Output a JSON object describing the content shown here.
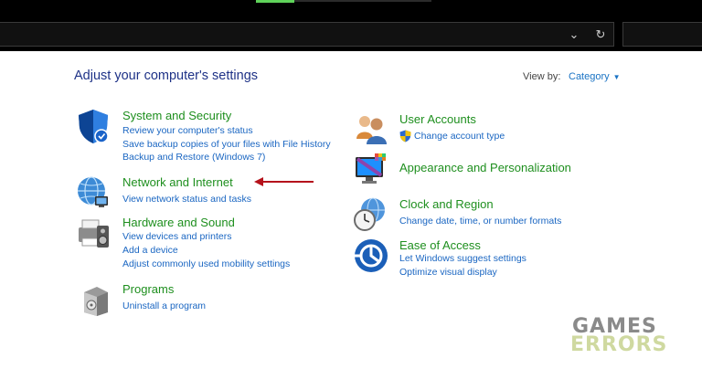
{
  "header": {
    "page_title": "Adjust your computer's settings",
    "view_by_label": "View by:",
    "view_by_value": "Category"
  },
  "categories": [
    {
      "title": "System and Security",
      "icon": "shield-icon",
      "links": [
        "Review your computer's status",
        "Save backup copies of your files with File History",
        "Backup and Restore (Windows 7)"
      ]
    },
    {
      "title": "Network and Internet",
      "icon": "globe-network-icon",
      "links": [
        "View network status and tasks"
      ]
    },
    {
      "title": "Hardware and Sound",
      "icon": "printer-speaker-icon",
      "links": [
        "View devices and printers",
        "Add a device",
        "Adjust commonly used mobility settings"
      ]
    },
    {
      "title": "Programs",
      "icon": "programs-box-icon",
      "links": [
        "Uninstall a program"
      ]
    },
    {
      "title": "User Accounts",
      "icon": "users-icon",
      "links": [
        "Change account type"
      ]
    },
    {
      "title": "Appearance and Personalization",
      "icon": "monitor-paint-icon",
      "links": []
    },
    {
      "title": "Clock and Region",
      "icon": "clock-globe-icon",
      "links": [
        "Change date, time, or number formats"
      ]
    },
    {
      "title": "Ease of Access",
      "icon": "ease-of-access-icon",
      "links": [
        "Let Windows suggest settings",
        "Optimize visual display"
      ]
    }
  ],
  "watermark": {
    "line1": "GAMES",
    "line2": "ERRORS"
  },
  "colors": {
    "heading": "#1e8f1e",
    "link": "#1a66c2",
    "title": "#1e3287",
    "arrow": "#b5121b"
  }
}
